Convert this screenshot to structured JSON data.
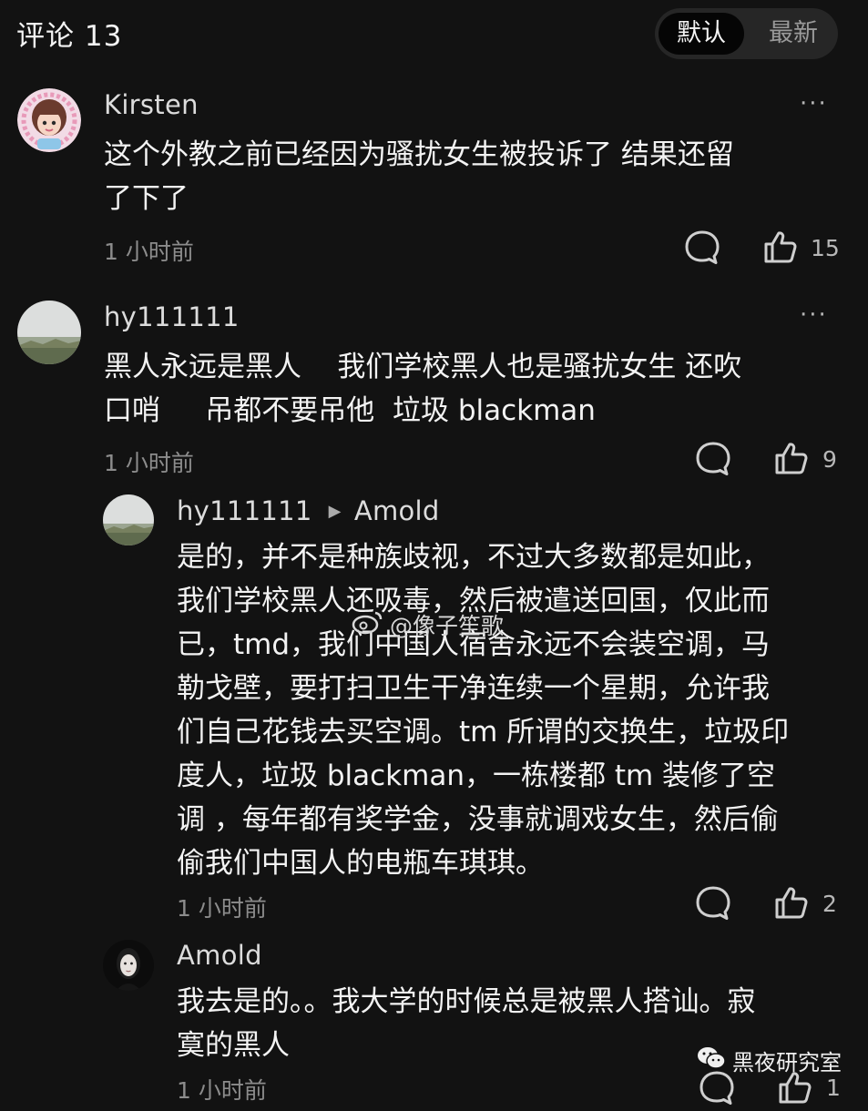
{
  "header": {
    "title": "评论 13",
    "sort_default": "默认",
    "sort_latest": "最新"
  },
  "comments": [
    {
      "author": "Kirsten",
      "avatar_icon": "cartoon-girl-avatar",
      "text": "这个外教之前已经因为骚扰女生被投诉了 结果还留\n了下了",
      "time": "1 小时前",
      "likes": "15",
      "more": "···"
    },
    {
      "author": "hy111111",
      "avatar_icon": "landscape-avatar",
      "text": "黑人永远是黑人    我们学校黑人也是骚扰女生 还吹\n口哨     吊都不要吊他  垃圾 blackman",
      "time": "1 小时前",
      "likes": "9",
      "more": "···",
      "replies": [
        {
          "author": "hy111111",
          "reply_to": "Amold",
          "avatar_icon": "landscape-avatar",
          "text": "是的，并不是种族歧视，不过大多数都是如此，\n我们学校黑人还吸毒，然后被遣送回国，仅此而\n已，tmd，我们中国人宿舍永远不会装空调，马\n勒戈壁，要打扫卫生干净连续一个星期，允许我\n们自己花钱去买空调。tm 所谓的交换生，垃圾印\n度人，垃圾 blackman，一栋楼都 tm 装修了空\n调 ，每年都有奖学金，没事就调戏女生，然后偷\n偷我们中国人的电瓶车琪琪。",
          "time": "1 小时前",
          "likes": "2"
        },
        {
          "author": "Amold",
          "avatar_icon": "woman-portrait-avatar",
          "text": "我去是的。。我大学的时候总是被黑人搭讪。寂\n寞的黑人",
          "time": "1 小时前",
          "likes": "1"
        }
      ]
    }
  ],
  "watermarks": {
    "weibo": "@像子笙歌",
    "wechat": "黑夜研究室"
  },
  "colors": {
    "background": "#121212",
    "text": "#f3f3f3",
    "secondary": "#8c8c8c"
  }
}
